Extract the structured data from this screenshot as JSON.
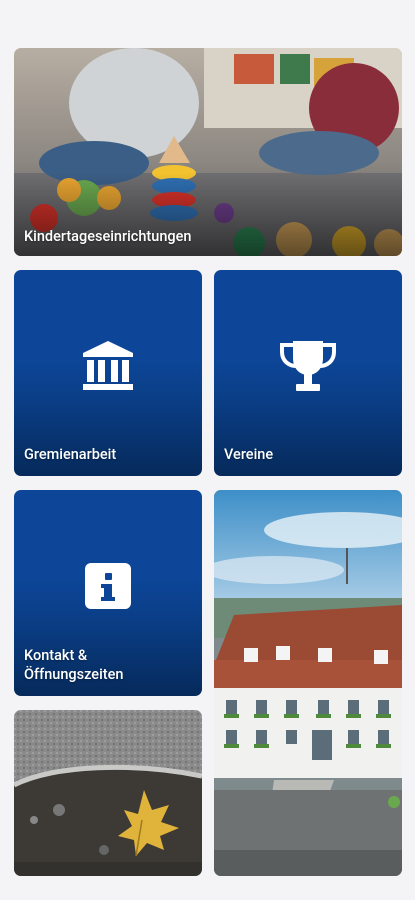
{
  "tiles": {
    "kindergarten": {
      "label": "Kindertageseinrichtungen",
      "icon": "toys-photo"
    },
    "committee": {
      "label": "Gremienarbeit",
      "icon": "building-columns-icon"
    },
    "clubs": {
      "label": "Vereine",
      "icon": "trophy-icon"
    },
    "contact": {
      "label": "Kontakt &\nÖffnungszeiten",
      "icon": "info-icon"
    },
    "townhall": {
      "label": "",
      "icon": "town-hall-photo"
    },
    "leaf": {
      "label": "",
      "icon": "leaf-on-asphalt-photo"
    }
  },
  "colors": {
    "tile_blue_top": "#0d4699",
    "tile_blue_bottom": "#062a5b",
    "label_text": "#ffffff"
  }
}
